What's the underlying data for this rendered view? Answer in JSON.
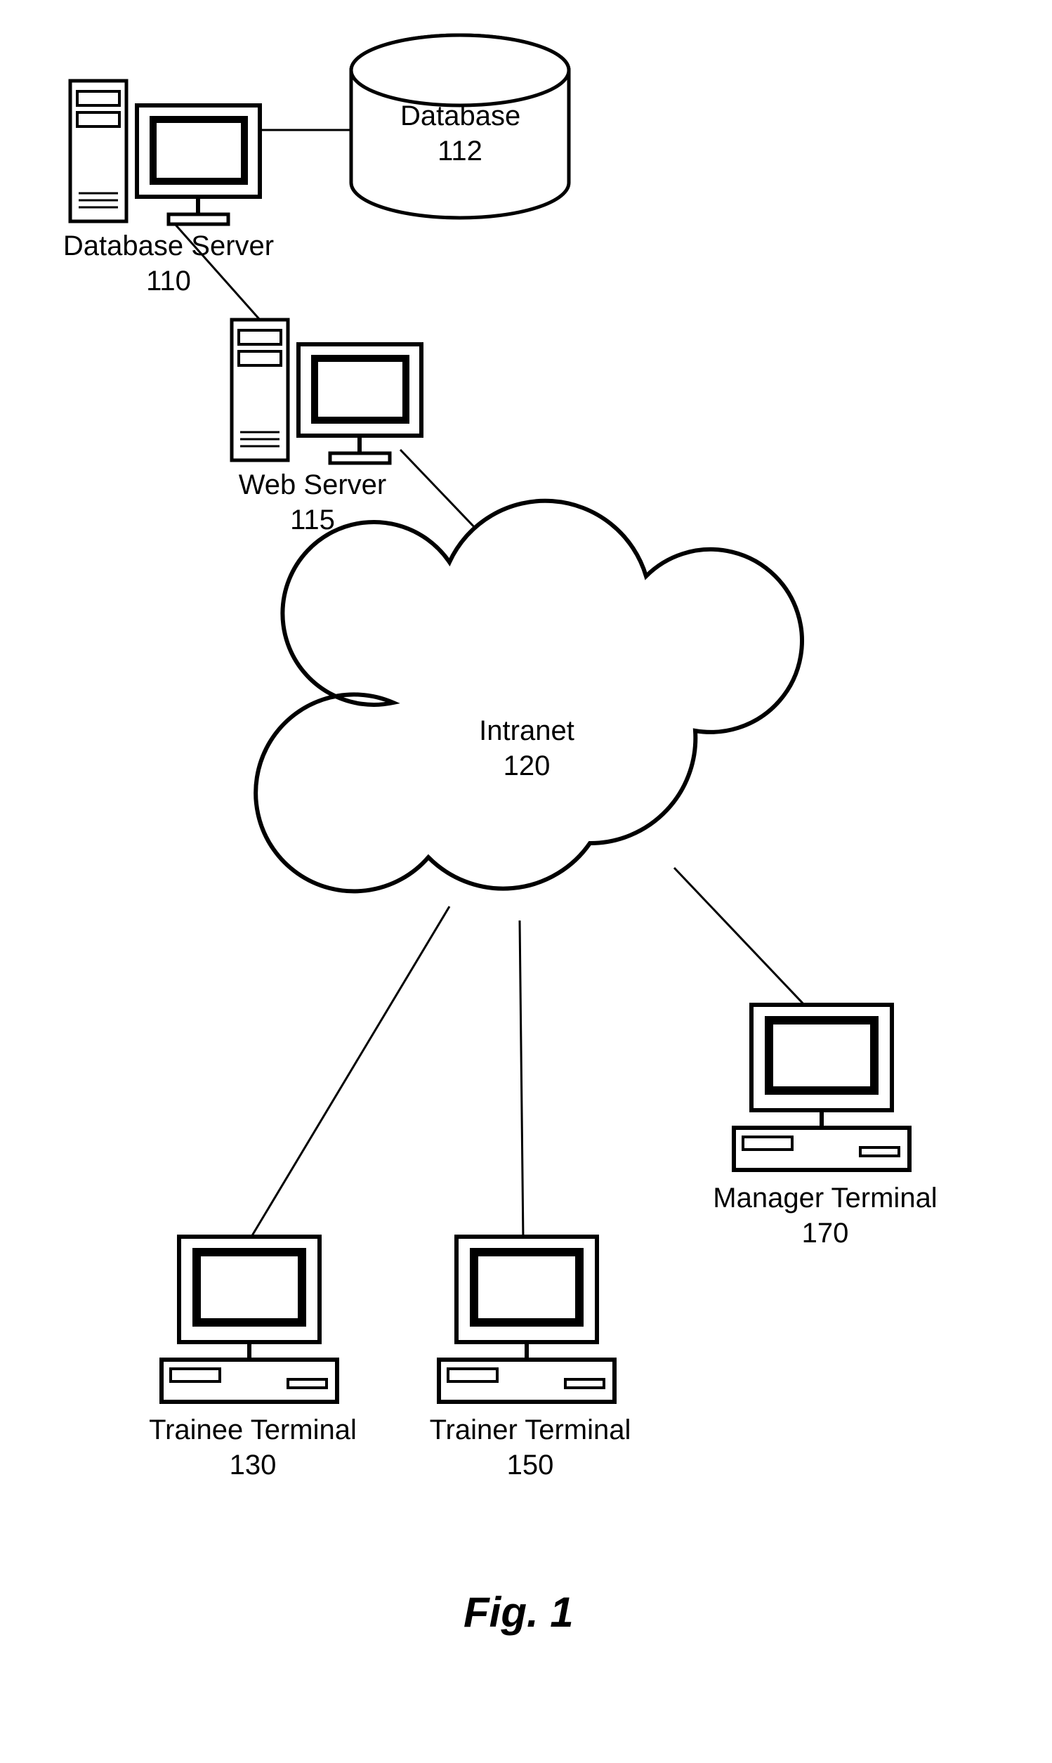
{
  "nodes": {
    "database": {
      "name": "Database",
      "ref": "112"
    },
    "databaseServer": {
      "name": "Database Server",
      "ref": "110"
    },
    "webServer": {
      "name": "Web Server",
      "ref": "115"
    },
    "intranet": {
      "name": "Intranet",
      "ref": "120"
    },
    "managerTerminal": {
      "name": "Manager Terminal",
      "ref": "170"
    },
    "traineeTerminal": {
      "name": "Trainee Terminal",
      "ref": "130"
    },
    "trainerTerminal": {
      "name": "Trainer Terminal",
      "ref": "150"
    }
  },
  "figure": "Fig. 1"
}
